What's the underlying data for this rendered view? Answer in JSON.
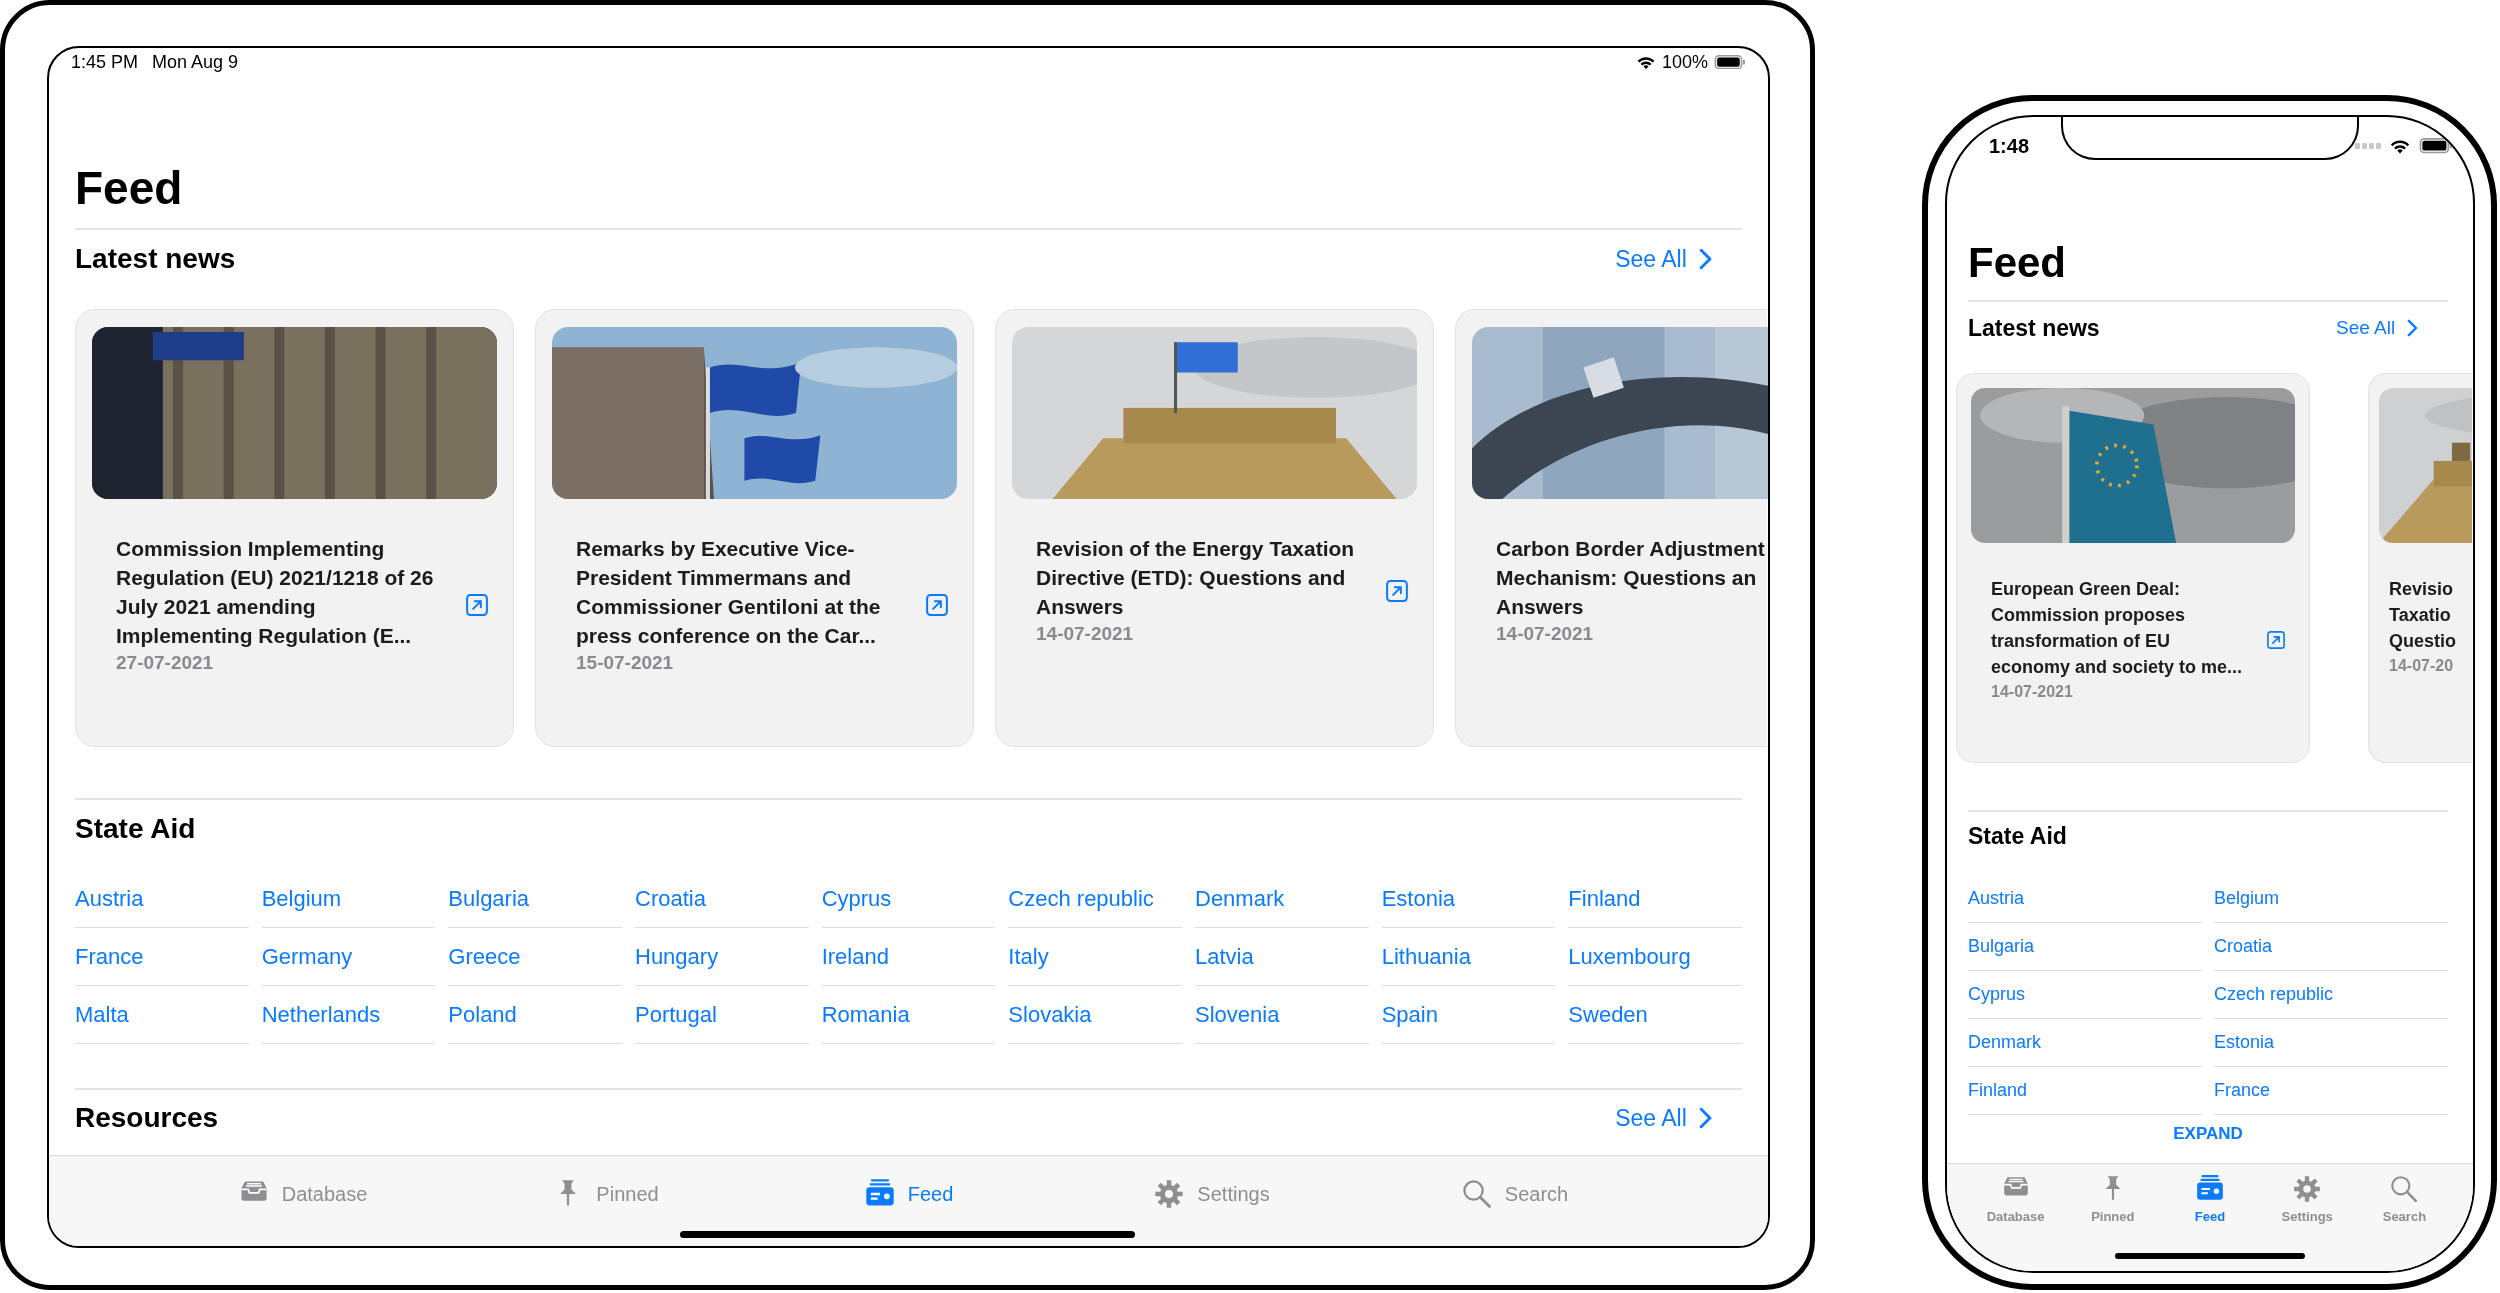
{
  "tablet": {
    "status_bar": {
      "time": "1:45 PM",
      "date": "Mon Aug 9",
      "battery": "100%"
    },
    "title": "Feed",
    "latest_news": {
      "heading": "Latest news",
      "see_all": "See All",
      "cards": [
        {
          "kind": "full",
          "title": "Commission Implementing Regulation (EU) 2021/1218 of 26 July 2021 amending Implementing Regulation (E...",
          "date": "27-07-2021"
        },
        {
          "kind": "full",
          "title": "Remarks by Executive Vice-President Timmermans and Commissioner Gentiloni at the press conference on the Car...",
          "date": "15-07-2021"
        },
        {
          "kind": "full",
          "title": "Revision of the Energy Taxation Directive (ETD): Questions and Answers",
          "date": "14-07-2021"
        },
        {
          "kind": "partial",
          "lines": [
            "Carbon Border Adjustment",
            "Mechanism: Questions an",
            "Answers"
          ],
          "date": "14-07-2021"
        }
      ]
    },
    "state_aid": {
      "heading": "State Aid",
      "countries": [
        "Austria",
        "Belgium",
        "Bulgaria",
        "Croatia",
        "Cyprus",
        "Czech republic",
        "Denmark",
        "Estonia",
        "Finland",
        "France",
        "Germany",
        "Greece",
        "Hungary",
        "Ireland",
        "Italy",
        "Latvia",
        "Lithuania",
        "Luxembourg",
        "Malta",
        "Netherlands",
        "Poland",
        "Portugal",
        "Romania",
        "Slovakia",
        "Slovenia",
        "Spain",
        "Sweden"
      ]
    },
    "resources": {
      "heading": "Resources",
      "see_all": "See All"
    },
    "tab_bar": [
      {
        "label": "Database",
        "selected": false
      },
      {
        "label": "Pinned",
        "selected": false
      },
      {
        "label": "Feed",
        "selected": true
      },
      {
        "label": "Settings",
        "selected": false
      },
      {
        "label": "Search",
        "selected": false
      }
    ]
  },
  "phone": {
    "status_bar": {
      "time": "1:48"
    },
    "title": "Feed",
    "latest_news": {
      "heading": "Latest news",
      "see_all": "See All",
      "cards": [
        {
          "kind": "full",
          "title": "European Green Deal: Commission proposes transformation of EU economy and society to me...",
          "date": "14-07-2021"
        },
        {
          "kind": "partial",
          "lines": [
            "Revisio",
            "Taxatio",
            "Questio"
          ],
          "date": "14-07-20"
        }
      ]
    },
    "state_aid": {
      "heading": "State Aid",
      "countries": [
        "Austria",
        "Belgium",
        "Bulgaria",
        "Croatia",
        "Cyprus",
        "Czech republic",
        "Denmark",
        "Estonia",
        "Finland",
        "France"
      ],
      "expand": "EXPAND"
    },
    "tab_bar": [
      {
        "label": "Database",
        "selected": false
      },
      {
        "label": "Pinned",
        "selected": false
      },
      {
        "label": "Feed",
        "selected": true
      },
      {
        "label": "Settings",
        "selected": false
      },
      {
        "label": "Search",
        "selected": false
      }
    ]
  }
}
